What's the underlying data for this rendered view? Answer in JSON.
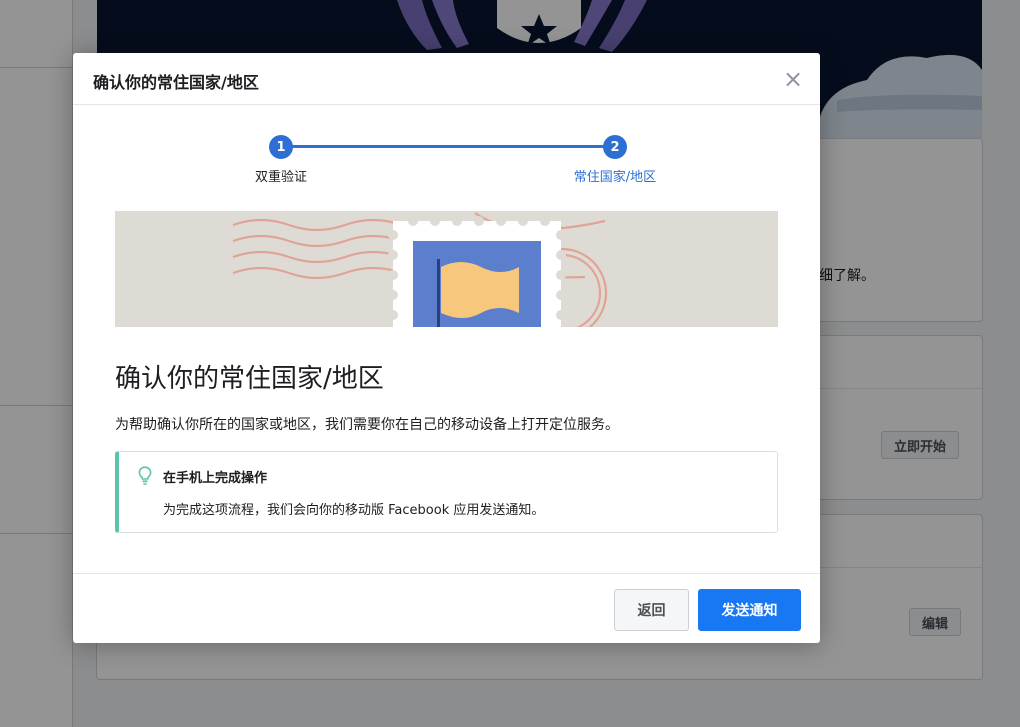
{
  "background": {
    "card_text": "细了解。",
    "start_button": "立即开始",
    "edit_button": "编辑"
  },
  "modal": {
    "title": "确认你的常住国家/地区",
    "close_icon": "close-icon",
    "stepper": {
      "steps": [
        {
          "number": "1",
          "label": "双重验证",
          "state": "completed"
        },
        {
          "number": "2",
          "label": "常住国家/地区",
          "state": "active"
        }
      ]
    },
    "content": {
      "heading": "确认你的常住国家/地区",
      "description": "为帮助确认你所在的国家或地区，我们需要你在自己的移动设备上打开定位服务。"
    },
    "tip": {
      "icon": "lightbulb-icon",
      "title": "在手机上完成操作",
      "text": "为完成这项流程，我们会向你的移动版 Facebook 应用发送通知。"
    },
    "footer": {
      "back_button": "返回",
      "send_button": "发送通知"
    }
  },
  "colors": {
    "primary": "#1877f2",
    "step_active": "#2d6fd2",
    "tip_accent": "#5cc4ad",
    "illustration_bg": "#dedbd5",
    "stamp_flag": "#f7c77c",
    "stamp_blue": "#5b7fcc"
  }
}
